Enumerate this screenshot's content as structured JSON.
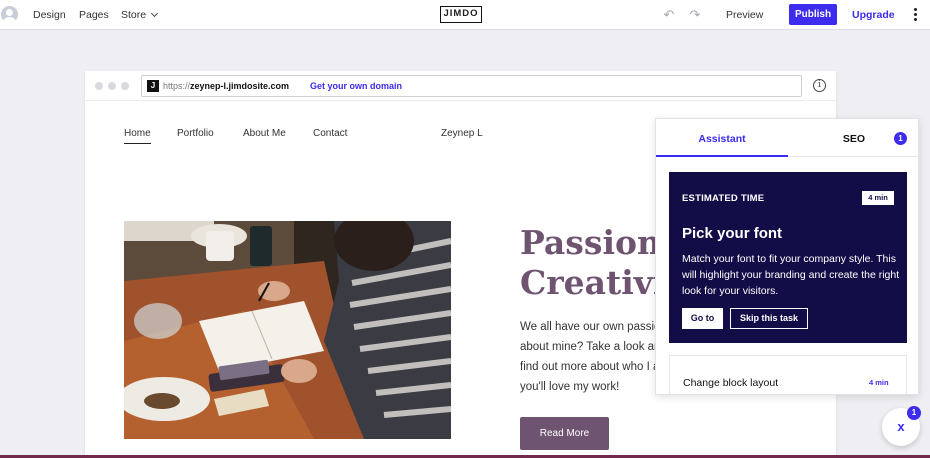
{
  "topbar": {
    "nav": [
      "Design",
      "Pages",
      "Store"
    ],
    "logo": "JIMDO",
    "preview": "Preview",
    "publish": "Publish",
    "upgrade": "Upgrade"
  },
  "browser": {
    "favicon": "J",
    "url_protocol": "https://",
    "url_host": "zeynep-l.jimdosite.com",
    "own_domain": "Get your own domain"
  },
  "site": {
    "nav": [
      "Home",
      "Portfolio",
      "About Me",
      "Contact"
    ],
    "site_name": "Zeynep L",
    "headline_line1": "Passionate",
    "headline_line2": "Creativity",
    "body_lines": [
      "We all have our own passion.",
      "about mine? Take a look around",
      "find out more about who I am.",
      "you'll love my work!"
    ],
    "read_more": "Read More"
  },
  "assistant": {
    "tab_assistant": "Assistant",
    "tab_seo": "SEO",
    "seo_count": "1",
    "task": {
      "estimated_label": "ESTIMATED TIME",
      "minutes": "4 min",
      "title": "Pick your font",
      "description": "Match your font to fit your company style. This will highlight your branding and create the right look for your visitors.",
      "go_to": "Go to",
      "skip": "Skip this task"
    },
    "next_task": {
      "title": "Change block layout",
      "minutes": "4 min"
    }
  },
  "fab": {
    "icon_glyph": "x",
    "badge": "1"
  },
  "colors": {
    "accent": "#3d2bee",
    "brand_purple": "#6f5472",
    "task_card": "#130d47"
  }
}
